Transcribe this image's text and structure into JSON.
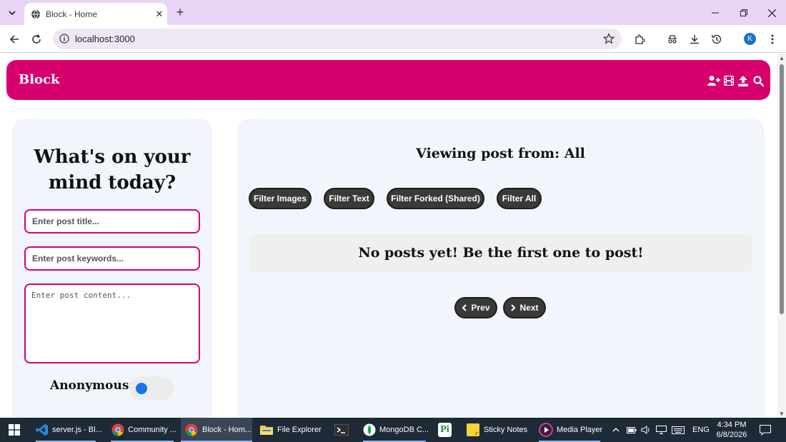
{
  "browser": {
    "tab_title": "Block - Home",
    "url": "localhost:3000",
    "profile_initial": "K"
  },
  "header": {
    "brand": "Block",
    "icons": [
      "add-user-icon",
      "film-icon",
      "upload-icon",
      "search-icon"
    ]
  },
  "composer": {
    "heading": "What's on your mind today?",
    "title_placeholder": "Enter post title...",
    "keywords_placeholder": "Enter post keywords...",
    "content_placeholder": "Enter post content...",
    "anonymous_label": "Anonymous:",
    "anonymous_on": false
  },
  "feed": {
    "heading": "Viewing post from: All",
    "filters": [
      "Filter Images",
      "Filter Text",
      "Filter Forked (Shared)",
      "Filter All"
    ],
    "empty_message": "No posts yet! Be the first one to post!",
    "prev_label": "Prev",
    "next_label": "Next"
  },
  "taskbar": {
    "apps": [
      {
        "label": "server.js - Bl...",
        "icon": "vscode-icon"
      },
      {
        "label": "Community ...",
        "icon": "chrome-icon"
      },
      {
        "label": "Block - Hom...",
        "icon": "chrome-icon"
      },
      {
        "label": "File Explorer",
        "icon": "folder-icon"
      },
      {
        "label": "",
        "icon": "terminal-icon"
      },
      {
        "label": "MongoDB C...",
        "icon": "mongodb-icon"
      },
      {
        "label": "",
        "icon": "pi-icon"
      },
      {
        "label": "Sticky Notes",
        "icon": "sticky-notes-icon"
      },
      {
        "label": "Media Player",
        "icon": "media-player-icon"
      }
    ],
    "language": "ENG",
    "time": "4:34 PM",
    "date": "6/8/2026"
  },
  "colors": {
    "accent": "#d6006f",
    "panel_bg": "#f2f6fc",
    "button_bg": "#3a3a3a",
    "toggle_knob": "#1a73e8"
  }
}
